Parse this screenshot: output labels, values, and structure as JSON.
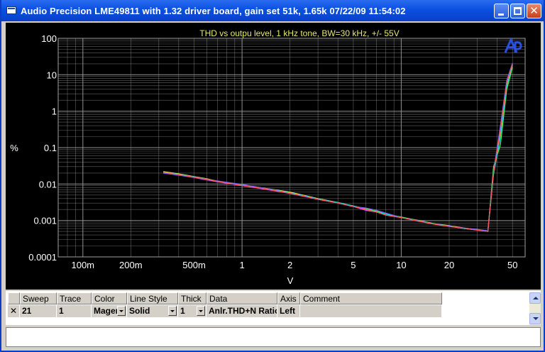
{
  "window": {
    "title": "Audio Precision  LME49811 with 1.32 driver board, gain set 51k, 1.65k  07/22/09 11:54:02",
    "close_glyph": "✕"
  },
  "chart_data": {
    "type": "line",
    "title": "THD vs outpu level, 1 kHz tone, BW=30 kHz, +/- 55V",
    "xlabel": "V",
    "ylabel": "%",
    "x_scale": "log",
    "y_scale": "log",
    "xlim": [
      0.07,
      60
    ],
    "ylim": [
      0.0001,
      100
    ],
    "grid": true,
    "x_tick_labels": [
      {
        "v": 0.1,
        "t": "100m"
      },
      {
        "v": 0.2,
        "t": "200m"
      },
      {
        "v": 0.5,
        "t": "500m"
      },
      {
        "v": 1,
        "t": "1"
      },
      {
        "v": 2,
        "t": "2"
      },
      {
        "v": 5,
        "t": "5"
      },
      {
        "v": 10,
        "t": "10"
      },
      {
        "v": 20,
        "t": "20"
      },
      {
        "v": 50,
        "t": "50"
      }
    ],
    "y_tick_labels": [
      {
        "v": 100,
        "t": "100"
      },
      {
        "v": 10,
        "t": "10"
      },
      {
        "v": 1,
        "t": "1"
      },
      {
        "v": 0.1,
        "t": "0.1"
      },
      {
        "v": 0.01,
        "t": "0.01"
      },
      {
        "v": 0.001,
        "t": "0.001"
      },
      {
        "v": 0.0001,
        "t": "0.0001"
      }
    ],
    "series": [
      {
        "color": "#ff3cff",
        "x": [
          0.32,
          0.4,
          0.5,
          0.6,
          0.7,
          0.8,
          1,
          1.3,
          1.6,
          2,
          2.5,
          3,
          4,
          5,
          6,
          7,
          8,
          10,
          13,
          16,
          20,
          25,
          30,
          35,
          38,
          42,
          46,
          50
        ],
        "y": [
          0.021,
          0.018,
          0.015,
          0.013,
          0.0115,
          0.0105,
          0.009,
          0.0075,
          0.0065,
          0.0055,
          0.0045,
          0.0038,
          0.003,
          0.0024,
          0.0019,
          0.0017,
          0.0014,
          0.0012,
          0.00095,
          0.0008,
          0.0007,
          0.0006,
          0.00055,
          0.0005,
          0.02,
          0.3,
          6,
          20
        ]
      },
      {
        "color": "#ffff40",
        "x": [
          0.32,
          0.4,
          0.5,
          0.6,
          0.7,
          0.8,
          1,
          1.3,
          1.6,
          2,
          2.5,
          3,
          4,
          5,
          6,
          7,
          8,
          10,
          13,
          16,
          20,
          25,
          30,
          35,
          38,
          42,
          46,
          50
        ],
        "y": [
          0.022,
          0.019,
          0.016,
          0.014,
          0.012,
          0.011,
          0.0095,
          0.008,
          0.007,
          0.006,
          0.0048,
          0.004,
          0.0031,
          0.0025,
          0.002,
          0.0017,
          0.0015,
          0.0012,
          0.001,
          0.00082,
          0.00072,
          0.00062,
          0.00056,
          0.00052,
          0.025,
          0.25,
          5,
          18
        ]
      },
      {
        "color": "#40ff40",
        "x": [
          0.32,
          0.4,
          0.5,
          0.6,
          0.7,
          0.8,
          1,
          1.3,
          1.6,
          2,
          2.5,
          3,
          4,
          5,
          6,
          7,
          8,
          10,
          13,
          16,
          20,
          25,
          30,
          35,
          38,
          42,
          46,
          50
        ],
        "y": [
          0.02,
          0.018,
          0.0155,
          0.0135,
          0.0118,
          0.0108,
          0.0092,
          0.0078,
          0.0068,
          0.0058,
          0.0046,
          0.0039,
          0.003,
          0.0025,
          0.0021,
          0.0018,
          0.0015,
          0.00125,
          0.00098,
          0.00082,
          0.0007,
          0.0006,
          0.00055,
          0.0005,
          0.03,
          0.12,
          4,
          16
        ]
      },
      {
        "color": "#00e0e0",
        "x": [
          0.32,
          0.4,
          0.5,
          0.6,
          0.7,
          0.8,
          1,
          1.3,
          1.6,
          2,
          2.5,
          3,
          4,
          5,
          6,
          7,
          8,
          10,
          13,
          16,
          20,
          25,
          30,
          35,
          38,
          42,
          46,
          50
        ],
        "y": [
          0.021,
          0.0185,
          0.0158,
          0.0138,
          0.012,
          0.011,
          0.0093,
          0.0079,
          0.0069,
          0.0057,
          0.0047,
          0.0039,
          0.0031,
          0.0025,
          0.002,
          0.0017,
          0.0015,
          0.0012,
          0.00096,
          0.0008,
          0.0007,
          0.0006,
          0.00055,
          0.0005,
          0.018,
          0.2,
          5,
          19
        ]
      },
      {
        "color": "#8060ff",
        "x": [
          0.32,
          0.4,
          0.5,
          0.6,
          0.7,
          0.8,
          1,
          1.3,
          1.6,
          2,
          2.5,
          3,
          4,
          5,
          6,
          7,
          8,
          10,
          13,
          16,
          20,
          25,
          30,
          35,
          38,
          42,
          46,
          50
        ],
        "y": [
          0.02,
          0.0175,
          0.0152,
          0.0132,
          0.0122,
          0.0112,
          0.0098,
          0.008,
          0.0068,
          0.0056,
          0.0046,
          0.0038,
          0.003,
          0.0024,
          0.0022,
          0.0019,
          0.0016,
          0.0012,
          0.00097,
          0.0008,
          0.0007,
          0.00062,
          0.00057,
          0.00052,
          0.022,
          0.4,
          7,
          21
        ]
      },
      {
        "color": "#ff5050",
        "x": [
          0.32,
          0.4,
          0.5,
          0.6,
          0.7,
          0.8,
          1,
          1.3,
          1.6,
          2,
          2.5,
          3,
          4,
          5,
          6,
          7,
          8,
          10,
          13,
          16,
          20,
          25,
          30,
          35,
          38,
          42,
          46,
          50
        ],
        "y": [
          0.021,
          0.018,
          0.0155,
          0.0136,
          0.0119,
          0.0106,
          0.0091,
          0.0077,
          0.0066,
          0.0056,
          0.0045,
          0.0038,
          0.003,
          0.0024,
          0.002,
          0.0017,
          0.0014,
          0.0012,
          0.00094,
          0.00079,
          0.00068,
          0.00061,
          0.00054,
          0.0005,
          0.02,
          0.3,
          6,
          20
        ]
      }
    ]
  },
  "sweep_table": {
    "headers": [
      "Sweep",
      "Trace",
      "Color",
      "Line Style",
      "Thick",
      "Data",
      "Axis",
      "Comment"
    ],
    "row": {
      "checked": "✕",
      "sweep": "21",
      "trace": "1",
      "color": "Magen",
      "line_style": "Solid",
      "thick": "1",
      "data": "Anlr.THD+N Ratio",
      "axis": "Left",
      "comment": ""
    }
  },
  "comment_box": {
    "value": ""
  },
  "colors": {
    "plot_bg": "#000000",
    "grid": "#a0a0a0",
    "title_text": "#e8e870",
    "logo": "#2a50e0"
  },
  "icons": {
    "app": "app-window-icon",
    "logo": "audio-precision-logo-icon"
  }
}
